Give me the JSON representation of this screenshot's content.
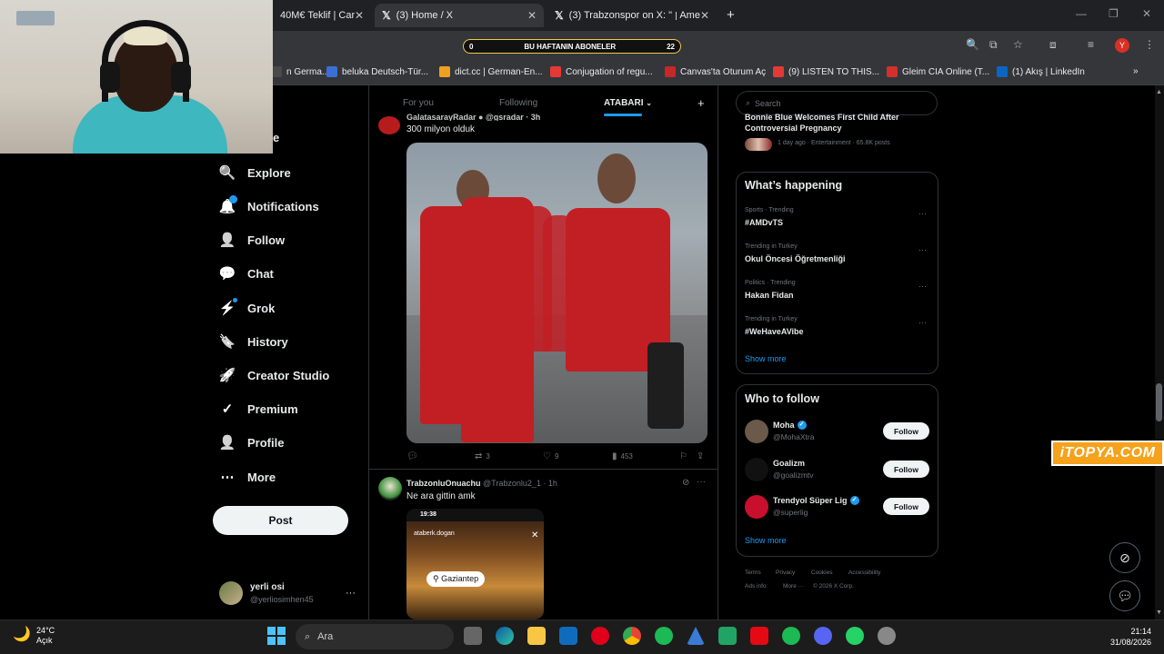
{
  "browser": {
    "tabs": [
      {
        "title": "40M€ Teklif | Cam",
        "active": false
      },
      {
        "title": "(3) Home / X",
        "active": true
      },
      {
        "title": "(3) Trabzonspor on X: \"",
        "suffix": "Ame",
        "active": false
      }
    ],
    "new_tab": "+",
    "banner": {
      "left": "0",
      "text": "BU HAFTANIN ABONELER",
      "right": "22"
    },
    "profile_initial": "Y",
    "bookmarks": [
      {
        "label": "n Germa...",
        "color": "#4a4a4a"
      },
      {
        "label": "beluka Deutsch-Tür...",
        "color": "#3b6fd6"
      },
      {
        "label": "dict.cc | German-En...",
        "color": "#f0a020"
      },
      {
        "label": "Conjugation of regu...",
        "color": "#e53935"
      },
      {
        "label": "Canvas'ta Oturum Aç",
        "color": "#c62828"
      },
      {
        "label": "(9) LISTEN TO THIS...",
        "color": "#e53935"
      },
      {
        "label": "Gleim CIA Online (T...",
        "color": "#d32f2f"
      },
      {
        "label": "(1) Akış | LinkedIn",
        "color": "#0a66c2"
      }
    ]
  },
  "nav": {
    "partial_label": "e",
    "items": [
      {
        "label": "Explore",
        "icon": "🔍"
      },
      {
        "label": "Notifications",
        "icon": "🔔"
      },
      {
        "label": "Follow",
        "icon": "👤"
      },
      {
        "label": "Chat",
        "icon": "💬"
      },
      {
        "label": "Grok",
        "icon": "⚡"
      },
      {
        "label": "History",
        "icon": "🔖"
      },
      {
        "label": "Creator Studio",
        "icon": "🚀"
      },
      {
        "label": "Premium",
        "icon": "✓"
      },
      {
        "label": "Profile",
        "icon": "👤"
      },
      {
        "label": "More",
        "icon": "⋯"
      }
    ],
    "post_label": "Post",
    "account": {
      "name": "yerli osi",
      "handle": "@yerliosimhen45",
      "menu": "···"
    }
  },
  "timeline": {
    "tabs": [
      "For you",
      "Following",
      "ATABARI"
    ],
    "add_tab": "+",
    "tweet1": {
      "header": "GalatasarayRadar ● @gsradar · 3h",
      "text": "300 milyon olduk",
      "stats": {
        "reply": "",
        "retweet": "3",
        "like": "9",
        "views": "453"
      }
    },
    "tweet2": {
      "name": "TrabzonluOnuachu",
      "handle": "@Trabzonlu2_1 · 1h",
      "text": "Ne ara gittin amk",
      "media": {
        "time": "19:38",
        "user": "ataberk.dogan",
        "location": "Gaziantep"
      }
    }
  },
  "sidebar": {
    "search_placeholder": "Search",
    "top_item": {
      "title_line1": "Bonnie Blue Welcomes First Child After",
      "title_line2": "Controversial Pregnancy",
      "meta": "1 day ago · Entertainment · 65.8K posts"
    },
    "happening": {
      "title": "What’s happening",
      "trends": [
        {
          "meta": "Sports · Trending",
          "name": "#AMDvTS"
        },
        {
          "meta": "Trending in Turkey",
          "name": "Okul Öncesi Öğretmenliği"
        },
        {
          "meta": "Politics · Trending",
          "name": "Hakan Fidan"
        },
        {
          "meta": "Trending in Turkey",
          "name": "#WeHaveAVibe"
        }
      ],
      "show_more": "Show more"
    },
    "who_to_follow": {
      "title": "Who to follow",
      "accounts": [
        {
          "name": "Moha",
          "handle": "@MohaXtra",
          "verified": true,
          "avatar_color": "#6b5a4a"
        },
        {
          "name": "Goalizm",
          "handle": "@goalizmtv",
          "verified": false,
          "avatar_color": "#111111"
        },
        {
          "name": "Trendyol Süper Lig",
          "handle": "@superlig",
          "verified": true,
          "avatar_color": "#c8102e"
        }
      ],
      "follow_label": "Follow",
      "show_more": "Show more"
    },
    "footer": [
      "Terms",
      "Privacy",
      "Cookies",
      "Accessibility",
      "Ads info",
      "More ···",
      "© 2026 X Corp."
    ]
  },
  "watermark": "iTOPYA.COM",
  "taskbar": {
    "weather_temp": "24°C",
    "weather_desc": "Açık",
    "search_placeholder": "Ara",
    "time": "21:14",
    "date": "31/08/2026"
  }
}
